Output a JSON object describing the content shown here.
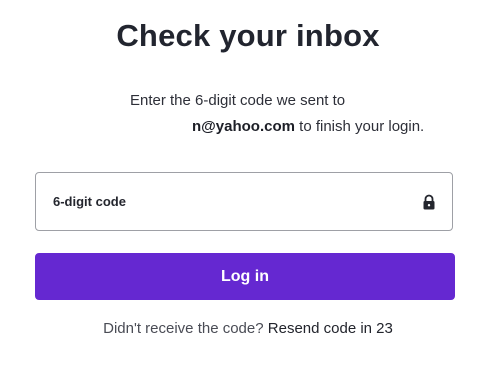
{
  "heading": "Check your inbox",
  "instructions": {
    "line1": "Enter the 6-digit code we sent to",
    "email_partial": "n@yahoo.com",
    "line2_suffix": " to finish your login."
  },
  "code_field": {
    "label": "6-digit code",
    "icon": "lock-icon"
  },
  "login_button": {
    "label": "Log in",
    "color": "#6528d1"
  },
  "resend": {
    "prompt": "Didn't receive the code?",
    "link_label": "Resend code in 23"
  }
}
